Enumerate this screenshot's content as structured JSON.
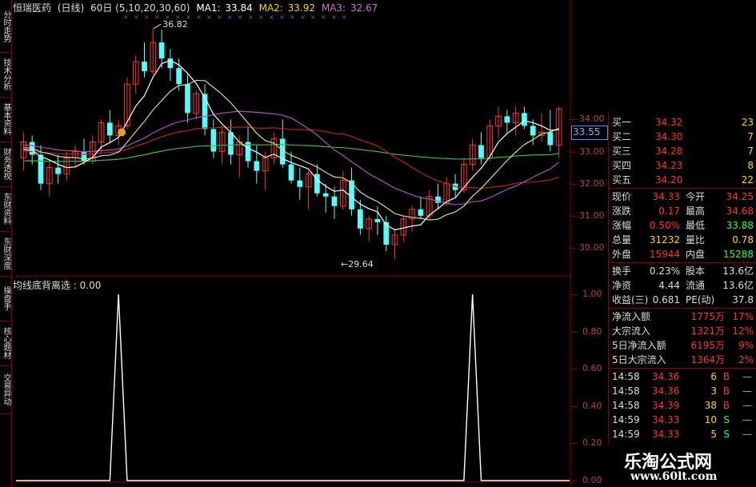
{
  "title": {
    "name": "恒瑞医药",
    "period": "(日线)",
    "ma_period": "60日",
    "ma_params": "(5,10,20,30,60)",
    "ma1_label": "MA1:",
    "ma1_value": "33.84",
    "ma2_label": "MA2:",
    "ma2_value": "33.92",
    "ma3_label": "MA3:",
    "ma3_value": "32.67",
    "colors": {
      "ma1": "#ffffff",
      "ma2": "#ffd700",
      "ma3": "#d070d0"
    }
  },
  "left_tabs": [
    "分时走势",
    "技术分析",
    "基本资料",
    "财务透视",
    "东财资料",
    "东财深度",
    "操盘手",
    "核心题材",
    "交易异动"
  ],
  "price_axis": {
    "current_price": "33.55",
    "ticks": [
      "34.00",
      "33.00",
      "32.00",
      "31.00",
      "30.00"
    ]
  },
  "annotations": {
    "high_label": "36.82",
    "low_label": "←29.64"
  },
  "oscillator": {
    "label": "均线底背离选 : 0.00",
    "ticks": [
      "1.00",
      "0.80",
      "0.60",
      "0.40",
      "0.20",
      "0.00"
    ]
  },
  "chart_data": {
    "type": "candlestick",
    "price_ylim": [
      29.64,
      36.82
    ],
    "osc_ylim": [
      0,
      1
    ],
    "osc_values": [
      0,
      0,
      0,
      0,
      0,
      0,
      0,
      0,
      0,
      0,
      0,
      0,
      0,
      0,
      0,
      0,
      0,
      0,
      0,
      0,
      0,
      0,
      0,
      0,
      0,
      0,
      0,
      0,
      0,
      0,
      0,
      0,
      0,
      0,
      0,
      0,
      0,
      0,
      0,
      0,
      0,
      0,
      0,
      0,
      0,
      0,
      0,
      0,
      0,
      0,
      0,
      0,
      0,
      0,
      0,
      0,
      0,
      0,
      0,
      0,
      0,
      0,
      0
    ],
    "osc_spikes": [
      11,
      52
    ],
    "candles": [
      [
        32.8,
        33.6,
        32.4,
        33.3
      ],
      [
        33.3,
        33.5,
        32.6,
        32.9
      ],
      [
        32.9,
        33.2,
        31.8,
        32.0
      ],
      [
        32.0,
        32.7,
        31.6,
        32.5
      ],
      [
        32.5,
        32.9,
        32.0,
        32.3
      ],
      [
        32.3,
        33.0,
        32.1,
        32.8
      ],
      [
        32.8,
        33.2,
        32.5,
        33.0
      ],
      [
        33.0,
        33.4,
        32.6,
        32.7
      ],
      [
        32.7,
        33.5,
        32.6,
        33.3
      ],
      [
        33.3,
        34.0,
        33.0,
        33.9
      ],
      [
        33.9,
        34.3,
        33.3,
        33.5
      ],
      [
        33.5,
        34.0,
        33.2,
        33.8
      ],
      [
        33.8,
        35.3,
        33.7,
        35.1
      ],
      [
        35.1,
        36.0,
        34.8,
        35.8
      ],
      [
        35.8,
        36.4,
        35.3,
        35.5
      ],
      [
        35.5,
        36.8,
        35.4,
        36.4
      ],
      [
        36.4,
        36.8,
        35.6,
        35.9
      ],
      [
        35.9,
        36.2,
        35.2,
        35.6
      ],
      [
        35.6,
        35.9,
        34.9,
        35.1
      ],
      [
        35.1,
        35.4,
        33.9,
        34.2
      ],
      [
        34.2,
        34.9,
        34.0,
        34.8
      ],
      [
        34.8,
        35.1,
        33.5,
        33.7
      ],
      [
        33.7,
        34.0,
        32.8,
        33.0
      ],
      [
        33.0,
        33.8,
        32.6,
        33.6
      ],
      [
        33.6,
        34.0,
        32.6,
        32.9
      ],
      [
        32.9,
        33.5,
        32.2,
        33.3
      ],
      [
        33.3,
        33.8,
        32.5,
        32.7
      ],
      [
        32.7,
        33.2,
        32.0,
        32.4
      ],
      [
        32.4,
        33.0,
        31.8,
        32.8
      ],
      [
        32.8,
        33.6,
        32.6,
        33.4
      ],
      [
        33.4,
        34.0,
        32.5,
        32.6
      ],
      [
        32.6,
        33.0,
        32.0,
        32.1
      ],
      [
        32.1,
        32.5,
        31.5,
        31.9
      ],
      [
        31.9,
        32.4,
        31.2,
        32.3
      ],
      [
        32.3,
        32.6,
        31.6,
        31.7
      ],
      [
        31.7,
        32.0,
        31.1,
        31.6
      ],
      [
        31.6,
        31.9,
        30.9,
        31.3
      ],
      [
        31.3,
        32.4,
        31.2,
        32.1
      ],
      [
        32.1,
        32.5,
        31.0,
        31.2
      ],
      [
        31.2,
        31.5,
        30.4,
        30.6
      ],
      [
        30.6,
        31.0,
        30.2,
        30.9
      ],
      [
        30.9,
        31.3,
        30.4,
        30.8
      ],
      [
        30.8,
        31.0,
        29.9,
        30.1
      ],
      [
        30.1,
        30.6,
        29.64,
        30.4
      ],
      [
        30.4,
        31.0,
        30.2,
        30.9
      ],
      [
        30.9,
        31.3,
        30.5,
        31.2
      ],
      [
        31.2,
        31.6,
        30.9,
        31.0
      ],
      [
        31.0,
        31.8,
        30.9,
        31.6
      ],
      [
        31.6,
        32.0,
        31.2,
        31.4
      ],
      [
        31.4,
        32.2,
        31.3,
        32.0
      ],
      [
        32.0,
        32.3,
        31.6,
        31.8
      ],
      [
        31.8,
        32.8,
        31.7,
        32.6
      ],
      [
        32.6,
        33.4,
        32.4,
        33.2
      ],
      [
        33.2,
        33.6,
        32.6,
        32.8
      ],
      [
        32.8,
        34.0,
        32.7,
        33.8
      ],
      [
        33.8,
        34.4,
        33.4,
        34.1
      ],
      [
        34.1,
        34.3,
        33.6,
        33.9
      ],
      [
        33.9,
        34.4,
        33.5,
        34.2
      ],
      [
        34.2,
        34.4,
        33.7,
        33.8
      ],
      [
        33.8,
        34.0,
        33.2,
        33.5
      ],
      [
        33.5,
        34.2,
        33.3,
        33.6
      ],
      [
        33.6,
        34.3,
        33.0,
        33.2
      ],
      [
        33.2,
        34.4,
        32.8,
        34.33
      ]
    ]
  },
  "quote": {
    "bids": [
      {
        "label": "买一",
        "price": "34.32",
        "vol": "23"
      },
      {
        "label": "买二",
        "price": "34.30",
        "vol": "7"
      },
      {
        "label": "买三",
        "price": "34.28",
        "vol": "7"
      },
      {
        "label": "买四",
        "price": "34.23",
        "vol": "8"
      },
      {
        "label": "买五",
        "price": "34.20",
        "vol": "22"
      }
    ],
    "stats": [
      {
        "l1": "现价",
        "v1": "34.33",
        "l2": "今开",
        "v2": "34.25",
        "c1": "#ff3333",
        "c2": "#ff3333"
      },
      {
        "l1": "涨跌",
        "v1": "0.17",
        "l2": "最高",
        "v2": "34.68",
        "c1": "#ff3333",
        "c2": "#ff3333"
      },
      {
        "l1": "涨幅",
        "v1": "0.50%",
        "l2": "最低",
        "v2": "33.88",
        "c1": "#ff3333",
        "c2": "#33ff33"
      },
      {
        "l1": "总量",
        "v1": "31232",
        "l2": "量比",
        "v2": "0.78",
        "c1": "#ffd700",
        "c2": "#ffd700"
      },
      {
        "l1": "外盘",
        "v1": "15944",
        "l2": "内盘",
        "v2": "15288",
        "c1": "#ff3333",
        "c2": "#33ff33"
      }
    ],
    "fundamentals": [
      {
        "l1": "换手",
        "v1": "0.23%",
        "l2": "股本",
        "v2": "13.6亿"
      },
      {
        "l1": "净资",
        "v1": "4.44",
        "l2": "流通",
        "v2": "13.6亿"
      },
      {
        "l1": "收益(三)",
        "v1": "0.681",
        "l2": "PE(动)",
        "v2": "37.8"
      }
    ],
    "flows": [
      {
        "label": "净流入额",
        "value": "1775万",
        "pct": "17%"
      },
      {
        "label": "大宗流入",
        "value": "1321万",
        "pct": "12%"
      },
      {
        "label": "5日净流入额",
        "value": "6195万",
        "pct": "9%"
      },
      {
        "label": "5日大宗流入",
        "value": "1364万",
        "pct": "2%"
      }
    ],
    "ticks": [
      {
        "time": "14:58",
        "price": "34.36",
        "vol": "6",
        "side": "B",
        "c": "#ff3333"
      },
      {
        "time": "14:58",
        "price": "34.36",
        "vol": "3",
        "side": "B",
        "c": "#ff3333"
      },
      {
        "time": "14:58",
        "price": "34.39",
        "vol": "38",
        "side": "B",
        "c": "#ff3333"
      },
      {
        "time": "14:59",
        "price": "34.33",
        "vol": "10",
        "side": "S",
        "c": "#33ff33"
      },
      {
        "time": "14:59",
        "price": "34.33",
        "vol": "5",
        "side": "S",
        "c": "#33ff33"
      }
    ]
  },
  "watermark": {
    "title": "乐淘公式网",
    "url": "www.60lt.com"
  }
}
